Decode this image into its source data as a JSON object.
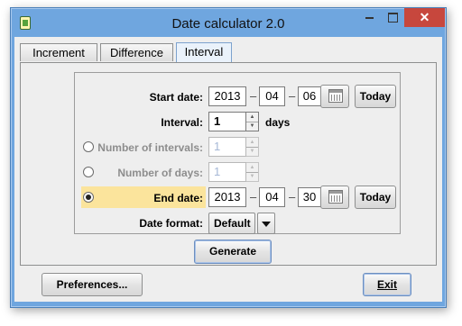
{
  "window": {
    "title": "Date calculator 2.0",
    "close_glyph": "✕"
  },
  "tabs": [
    {
      "label": "Increment",
      "active": false
    },
    {
      "label": "Difference",
      "active": false
    },
    {
      "label": "Interval",
      "active": true
    }
  ],
  "form": {
    "start_date": {
      "label": "Start date:",
      "year": "2013",
      "month": "04",
      "day": "06",
      "today_label": "Today"
    },
    "interval": {
      "label": "Interval:",
      "value": "1",
      "unit": "days"
    },
    "number_of_intervals": {
      "label": "Number of intervals:",
      "value": "1",
      "enabled": false,
      "selected": false
    },
    "number_of_days": {
      "label": "Number of days:",
      "value": "1",
      "enabled": false,
      "selected": false
    },
    "end_date": {
      "label": "End date:",
      "year": "2013",
      "month": "04",
      "day": "30",
      "today_label": "Today",
      "selected": true
    },
    "date_format": {
      "label": "Date format:",
      "value": "Default"
    },
    "separator": "–"
  },
  "buttons": {
    "generate": "Generate",
    "preferences": "Preferences...",
    "exit": "Exit"
  },
  "colors": {
    "titlebar": "#6fa6df",
    "close": "#c7473d",
    "highlight": "#fbe49c"
  }
}
